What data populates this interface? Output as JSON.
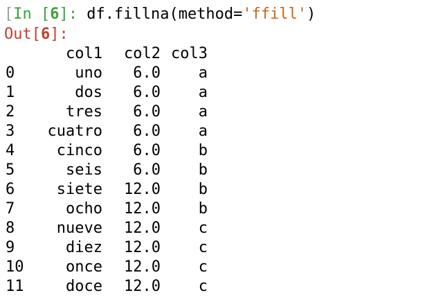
{
  "input": {
    "bracket_open": "[",
    "label": "In ",
    "number_open": "[",
    "number": "6",
    "number_close": "]",
    "colon": ": ",
    "code_prefix": "df.fillna(method=",
    "code_string": "'ffill'",
    "code_suffix": ")"
  },
  "output": {
    "label": "Out",
    "number_open": "[",
    "number": "6",
    "number_close": "]",
    "colon": ":"
  },
  "table": {
    "headers": [
      "col1",
      "col2",
      "col3"
    ],
    "rows": [
      {
        "index": "0",
        "col1": "uno",
        "col2": "6.0",
        "col3": "a"
      },
      {
        "index": "1",
        "col1": "dos",
        "col2": "6.0",
        "col3": "a"
      },
      {
        "index": "2",
        "col1": "tres",
        "col2": "6.0",
        "col3": "a"
      },
      {
        "index": "3",
        "col1": "cuatro",
        "col2": "6.0",
        "col3": "a"
      },
      {
        "index": "4",
        "col1": "cinco",
        "col2": "6.0",
        "col3": "b"
      },
      {
        "index": "5",
        "col1": "seis",
        "col2": "6.0",
        "col3": "b"
      },
      {
        "index": "6",
        "col1": "siete",
        "col2": "12.0",
        "col3": "b"
      },
      {
        "index": "7",
        "col1": "ocho",
        "col2": "12.0",
        "col3": "b"
      },
      {
        "index": "8",
        "col1": "nueve",
        "col2": "12.0",
        "col3": "c"
      },
      {
        "index": "9",
        "col1": "diez",
        "col2": "12.0",
        "col3": "c"
      },
      {
        "index": "10",
        "col1": "once",
        "col2": "12.0",
        "col3": "c"
      },
      {
        "index": "11",
        "col1": "doce",
        "col2": "12.0",
        "col3": "c"
      }
    ]
  },
  "colors": {
    "prompt_in": "#3aa33a",
    "prompt_out": "#c2412d",
    "string_literal": "#c2681f",
    "cursor_bracket": "#9e9e9e"
  }
}
